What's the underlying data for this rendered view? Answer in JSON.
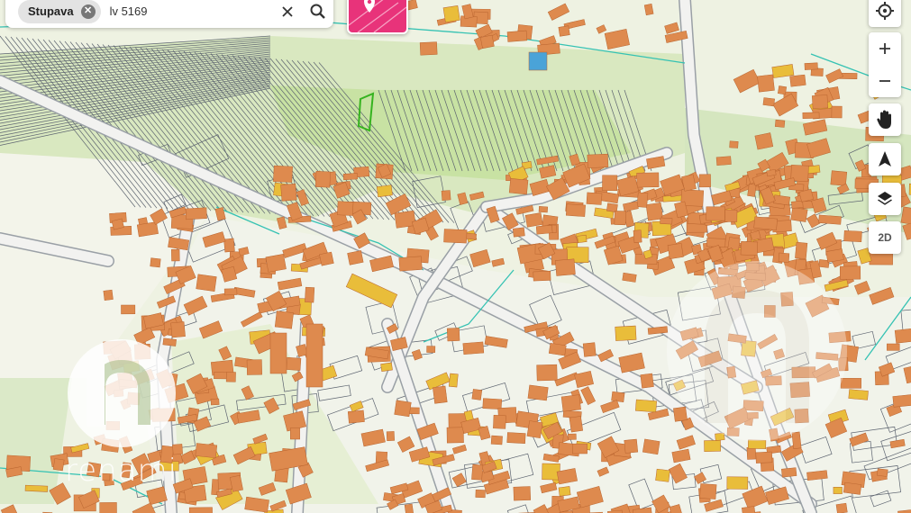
{
  "search": {
    "chip_label": "Stupava",
    "query": "lv 5169"
  },
  "controls": {
    "mode_label": "2D"
  },
  "watermark": {
    "brand_text": "renami"
  },
  "icons": [
    "close-icon",
    "search-icon",
    "map-marker-icon",
    "crosshair-icon",
    "plus-icon",
    "minus-icon",
    "hand-icon",
    "north-arrow-icon",
    "layers-icon"
  ],
  "colors": {
    "building": "#de8a4e",
    "building_yellow": "#e9bd3a",
    "parcel_line": "#59606b",
    "greenland": "#cfe3b0",
    "field": "#e3edcc",
    "cadastre_line": "#35c2b3",
    "accent": "#e8337a"
  }
}
